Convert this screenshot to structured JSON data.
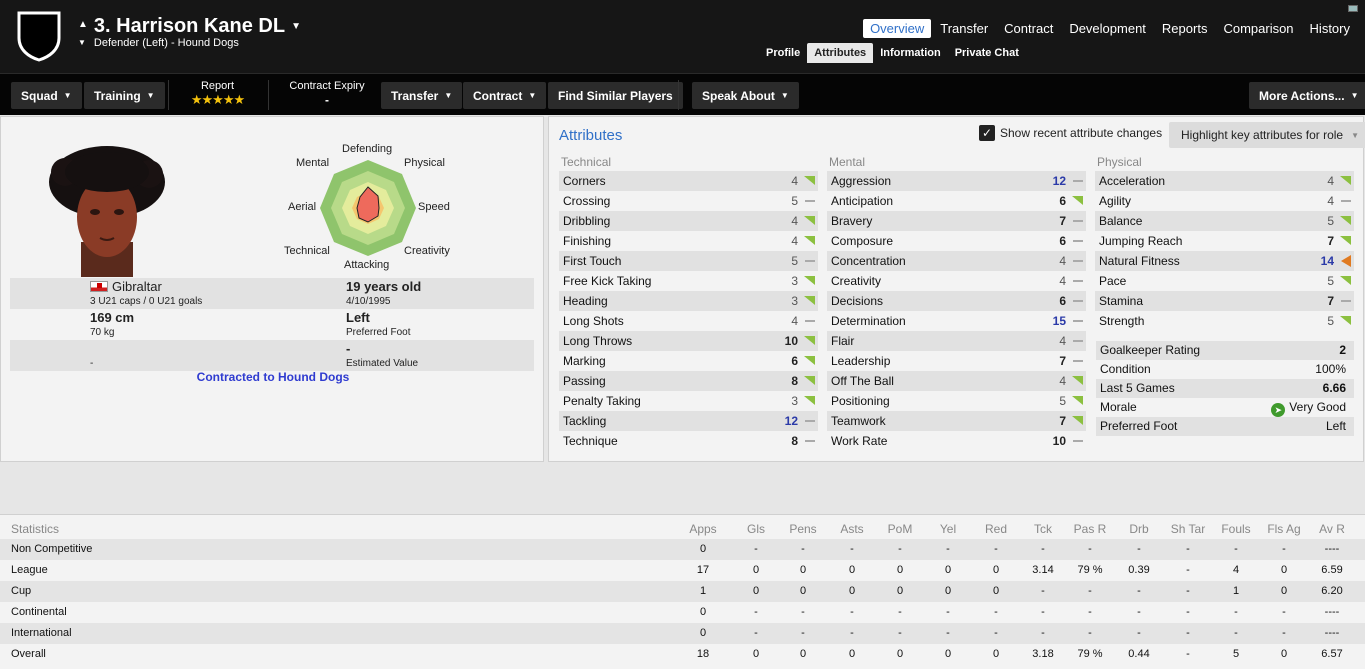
{
  "header": {
    "player_name": "3. Harrison Kane DL",
    "player_sub": "Defender (Left) - Hound Dogs",
    "main_tabs": [
      "Overview",
      "Transfer",
      "Contract",
      "Development",
      "Reports",
      "Comparison",
      "History"
    ],
    "sub_tabs": [
      "Profile",
      "Attributes",
      "Information",
      "Private Chat"
    ]
  },
  "toolbar": {
    "squad": "Squad",
    "training": "Training",
    "report_label": "Report",
    "report_stars": "★★★★★",
    "contract_expiry_label": "Contract Expiry",
    "contract_expiry_value": "-",
    "transfer": "Transfer",
    "contract": "Contract",
    "find_similar": "Find Similar Players",
    "speak_about": "Speak About",
    "more_actions": "More Actions..."
  },
  "profile": {
    "radar_labels": {
      "defending": "Defending",
      "physical": "Physical",
      "speed": "Speed",
      "creativity": "Creativity",
      "attacking": "Attacking",
      "technical": "Technical",
      "aerial": "Aerial",
      "mental": "Mental"
    },
    "nationality": "Gibraltar",
    "caps": "3 U21 caps / 0 U21 goals",
    "age": "19 years old",
    "dob": "4/10/1995",
    "height": "169 cm",
    "weight": "70 kg",
    "foot": "Left",
    "foot_label": "Preferred Foot",
    "row3_left": "-",
    "value": "-",
    "value_label": "Estimated Value",
    "contracted": "Contracted to Hound Dogs"
  },
  "attributes": {
    "title": "Attributes",
    "show_changes": "Show recent attribute changes",
    "highlight": "Highlight key attributes for role",
    "technical_title": "Technical",
    "mental_title": "Mental",
    "physical_title": "Physical",
    "technical": [
      {
        "name": "Corners",
        "value": "4",
        "trend": "up"
      },
      {
        "name": "Crossing",
        "value": "5",
        "trend": "flat"
      },
      {
        "name": "Dribbling",
        "value": "4",
        "trend": "up"
      },
      {
        "name": "Finishing",
        "value": "4",
        "trend": "up"
      },
      {
        "name": "First Touch",
        "value": "5",
        "trend": "flat"
      },
      {
        "name": "Free Kick Taking",
        "value": "3",
        "trend": "up"
      },
      {
        "name": "Heading",
        "value": "3",
        "trend": "up"
      },
      {
        "name": "Long Shots",
        "value": "4",
        "trend": "flat"
      },
      {
        "name": "Long Throws",
        "value": "10",
        "trend": "up"
      },
      {
        "name": "Marking",
        "value": "6",
        "trend": "up"
      },
      {
        "name": "Passing",
        "value": "8",
        "trend": "up"
      },
      {
        "name": "Penalty Taking",
        "value": "3",
        "trend": "up"
      },
      {
        "name": "Tackling",
        "value": "12",
        "trend": "flat"
      },
      {
        "name": "Technique",
        "value": "8",
        "trend": "flat"
      }
    ],
    "mental": [
      {
        "name": "Aggression",
        "value": "12",
        "trend": "flat"
      },
      {
        "name": "Anticipation",
        "value": "6",
        "trend": "up"
      },
      {
        "name": "Bravery",
        "value": "7",
        "trend": "flat"
      },
      {
        "name": "Composure",
        "value": "6",
        "trend": "flat"
      },
      {
        "name": "Concentration",
        "value": "4",
        "trend": "flat"
      },
      {
        "name": "Creativity",
        "value": "4",
        "trend": "flat"
      },
      {
        "name": "Decisions",
        "value": "6",
        "trend": "flat"
      },
      {
        "name": "Determination",
        "value": "15",
        "trend": "flat"
      },
      {
        "name": "Flair",
        "value": "4",
        "trend": "flat"
      },
      {
        "name": "Leadership",
        "value": "7",
        "trend": "flat"
      },
      {
        "name": "Off The Ball",
        "value": "4",
        "trend": "up"
      },
      {
        "name": "Positioning",
        "value": "5",
        "trend": "up"
      },
      {
        "name": "Teamwork",
        "value": "7",
        "trend": "up"
      },
      {
        "name": "Work Rate",
        "value": "10",
        "trend": "flat"
      }
    ],
    "physical": [
      {
        "name": "Acceleration",
        "value": "4",
        "trend": "up"
      },
      {
        "name": "Agility",
        "value": "4",
        "trend": "flat"
      },
      {
        "name": "Balance",
        "value": "5",
        "trend": "up"
      },
      {
        "name": "Jumping Reach",
        "value": "7",
        "trend": "up"
      },
      {
        "name": "Natural Fitness",
        "value": "14",
        "trend": "down"
      },
      {
        "name": "Pace",
        "value": "5",
        "trend": "up"
      },
      {
        "name": "Stamina",
        "value": "7",
        "trend": "flat"
      },
      {
        "name": "Strength",
        "value": "5",
        "trend": "up"
      }
    ],
    "summary": [
      {
        "name": "Goalkeeper Rating",
        "value": "2"
      },
      {
        "name": "Condition",
        "value": "100%"
      },
      {
        "name": "Last 5 Games",
        "value": "6.66"
      },
      {
        "name": "Morale",
        "value": "Very Good"
      },
      {
        "name": "Preferred Foot",
        "value": "Left"
      }
    ]
  },
  "statistics": {
    "title": "Statistics",
    "columns": [
      "Apps",
      "Gls",
      "Pens",
      "Asts",
      "PoM",
      "Yel",
      "Red",
      "Tck",
      "Pas R",
      "Drb",
      "Sh Tar",
      "Fouls",
      "Fls Ag",
      "Av R"
    ],
    "rows": [
      {
        "label": "Non Competitive",
        "values": [
          "0",
          "-",
          "-",
          "-",
          "-",
          "-",
          "-",
          "-",
          "-",
          "-",
          "-",
          "-",
          "-",
          "----"
        ]
      },
      {
        "label": "League",
        "values": [
          "17",
          "0",
          "0",
          "0",
          "0",
          "0",
          "0",
          "3.14",
          "79 %",
          "0.39",
          "-",
          "4",
          "0",
          "6.59"
        ]
      },
      {
        "label": "Cup",
        "values": [
          "1",
          "0",
          "0",
          "0",
          "0",
          "0",
          "0",
          "-",
          "-",
          "-",
          "-",
          "1",
          "0",
          "6.20"
        ]
      },
      {
        "label": "Continental",
        "values": [
          "0",
          "-",
          "-",
          "-",
          "-",
          "-",
          "-",
          "-",
          "-",
          "-",
          "-",
          "-",
          "-",
          "----"
        ]
      },
      {
        "label": "International",
        "values": [
          "0",
          "-",
          "-",
          "-",
          "-",
          "-",
          "-",
          "-",
          "-",
          "-",
          "-",
          "-",
          "-",
          "----"
        ]
      },
      {
        "label": "Overall",
        "values": [
          "18",
          "0",
          "0",
          "0",
          "0",
          "0",
          "0",
          "3.18",
          "79 %",
          "0.44",
          "-",
          "5",
          "0",
          "6.57"
        ]
      }
    ]
  }
}
